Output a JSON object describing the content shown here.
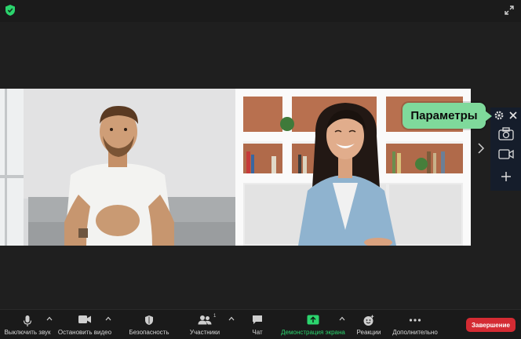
{
  "tooltip": {
    "label": "Параметры"
  },
  "toolbar": {
    "mute_label": "Выключить звук",
    "video_label": "Остановить видео",
    "security_label": "Безопасность",
    "participants_label": "Участники",
    "participants_count": "1",
    "chat_label": "Чат",
    "share_label": "Демонстрация экрана",
    "reactions_label": "Реакции",
    "more_label": "Дополнительно",
    "end_label": "Завершение"
  },
  "colors": {
    "accent_green": "#2bd46d",
    "tooltip_bg": "#7fd99b",
    "end_red": "#d42b33",
    "panel_bg": "#151d2b"
  },
  "icons": [
    "shield-icon",
    "fullscreen-icon",
    "gear-icon",
    "close-icon",
    "camera-snapshot-icon",
    "video-icon",
    "plus-icon",
    "chevron-right-icon",
    "microphone-icon",
    "video-camera-icon",
    "shield-security-icon",
    "participants-icon",
    "chat-icon",
    "share-screen-icon",
    "reaction-icon",
    "more-icon"
  ]
}
